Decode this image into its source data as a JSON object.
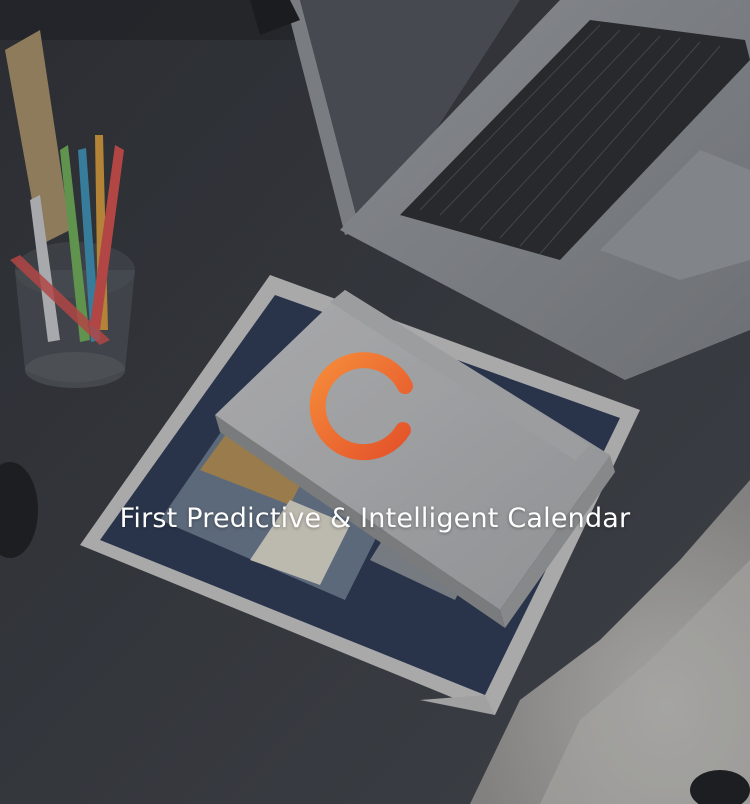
{
  "hero": {
    "tagline": "First Predictive & Intelligent Calendar",
    "logo_icon": "power-g-logo-icon",
    "logo_gradient": [
      "#f58b3a",
      "#e4522a"
    ]
  },
  "scene": {
    "description_icons": [
      "laptop-icon",
      "pencil-cup-icon",
      "notebook-icon",
      "magazine-icon",
      "fur-rug-icon",
      "mouse-icon"
    ]
  }
}
